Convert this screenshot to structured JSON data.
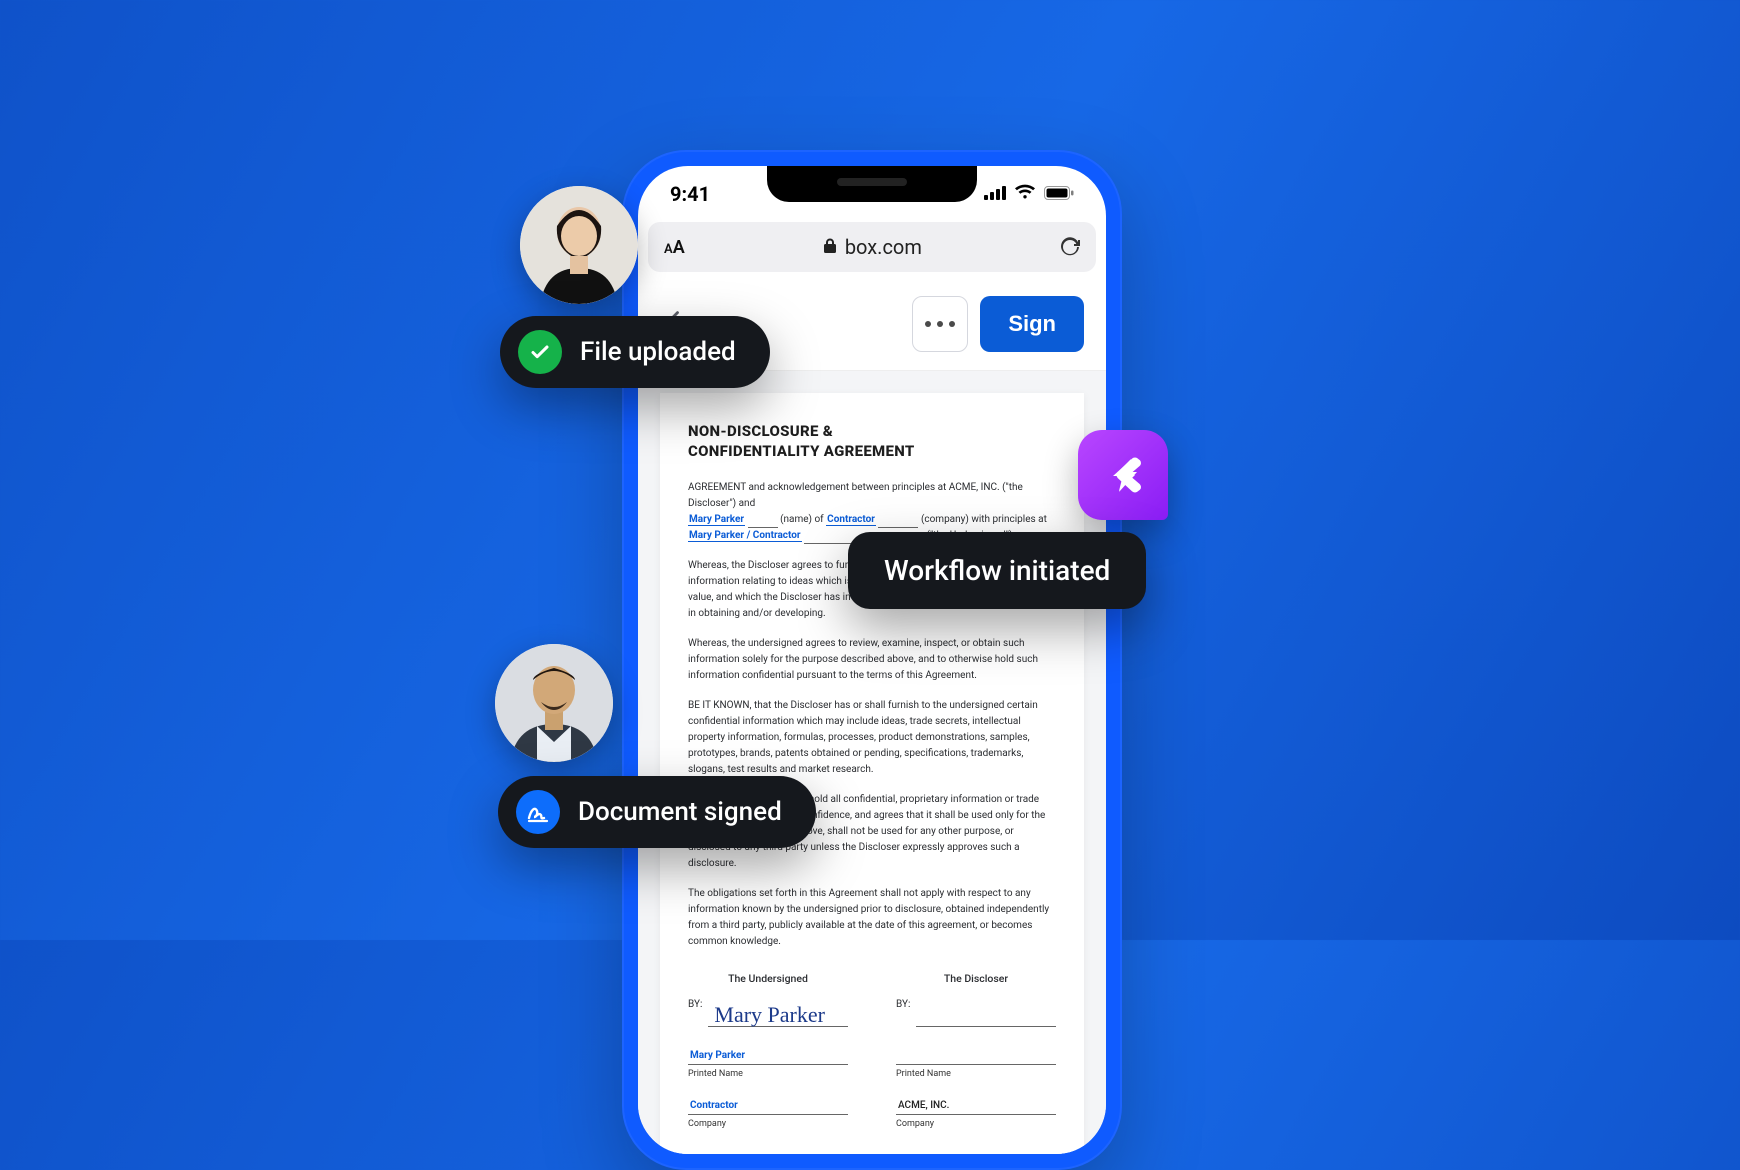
{
  "status": {
    "time": "9:41"
  },
  "urlbar": {
    "text_size_label": "A",
    "domain": "box.com"
  },
  "header": {
    "sign_label": "Sign"
  },
  "document": {
    "title_line1": "NON-DISCLOSURE &",
    "title_line2": "CONFIDENTIALITY AGREEMENT",
    "intro_prefix": "AGREEMENT and acknowledgement between principles at ACME, INC. (\"the Discloser\") and",
    "name_fill": "Mary Parker",
    "name_of": "(name) of",
    "role_fill": "Contractor",
    "company_with": "(company) with principles at",
    "combined_fill": "Mary Parker / Contractor",
    "undersigned_suffix": "(\"the Undersigned\").",
    "p1": "Whereas, the Discloser agrees to furnish the undersigned certain confidential information relating to ideas which is considered to be of significant economic value, and which the Discloser has invested substantial time, money, and resources in obtaining and/or developing.",
    "p2": "Whereas, the undersigned agrees to review, examine, inspect, or obtain such information solely for the purpose described above, and to otherwise hold such information confidential pursuant to the terms of this Agreement.",
    "p3": "BE IT KNOWN, that the Discloser has or shall furnish to the undersigned certain confidential information which may include ideas, trade secrets, intellectual property information, formulas, processes, product demonstrations, samples, prototypes, brands, patents obtained or pending, specifications, trademarks, slogans, test results and market research.",
    "p4": "The undersigned agrees to hold all confidential, proprietary information or trade secrets in strict trust and confidence, and agrees that it shall be used only for the contemplated purposes above, shall not be used for any other purpose, or disclosed to any third party unless the Discloser expressly approves such a disclosure.",
    "p5": "The obligations set forth in this Agreement shall not apply with respect to any information known by the undersigned prior to disclosure, obtained independently from a third party, publicly available at the date of this agreement, or becomes common knowledge.",
    "sig_left_heading": "The Undersigned",
    "sig_right_heading": "The Discloser",
    "by_label": "BY:",
    "signature_script": "Mary Parker",
    "printed_name_label": "Printed Name",
    "printed_name_value": "Mary Parker",
    "company_label": "Company",
    "company_value": "Contractor",
    "discloser_company": "ACME, INC."
  },
  "notifications": {
    "file_uploaded": "File uploaded",
    "workflow_initiated": "Workflow initiated",
    "document_signed": "Document signed"
  },
  "icons": {
    "check": "check-icon",
    "signature": "signature-icon",
    "workflow_app": "workflow-app-icon",
    "lock": "lock-icon",
    "refresh": "refresh-icon",
    "cellular": "cellular-icon",
    "wifi": "wifi-icon",
    "battery": "battery-icon"
  },
  "colors": {
    "accent_blue": "#0b5cd6",
    "badge_green": "#15b24a",
    "badge_blue": "#0d6dfb",
    "app_purple": "#9a2cf7",
    "pill_bg": "#15181d"
  }
}
